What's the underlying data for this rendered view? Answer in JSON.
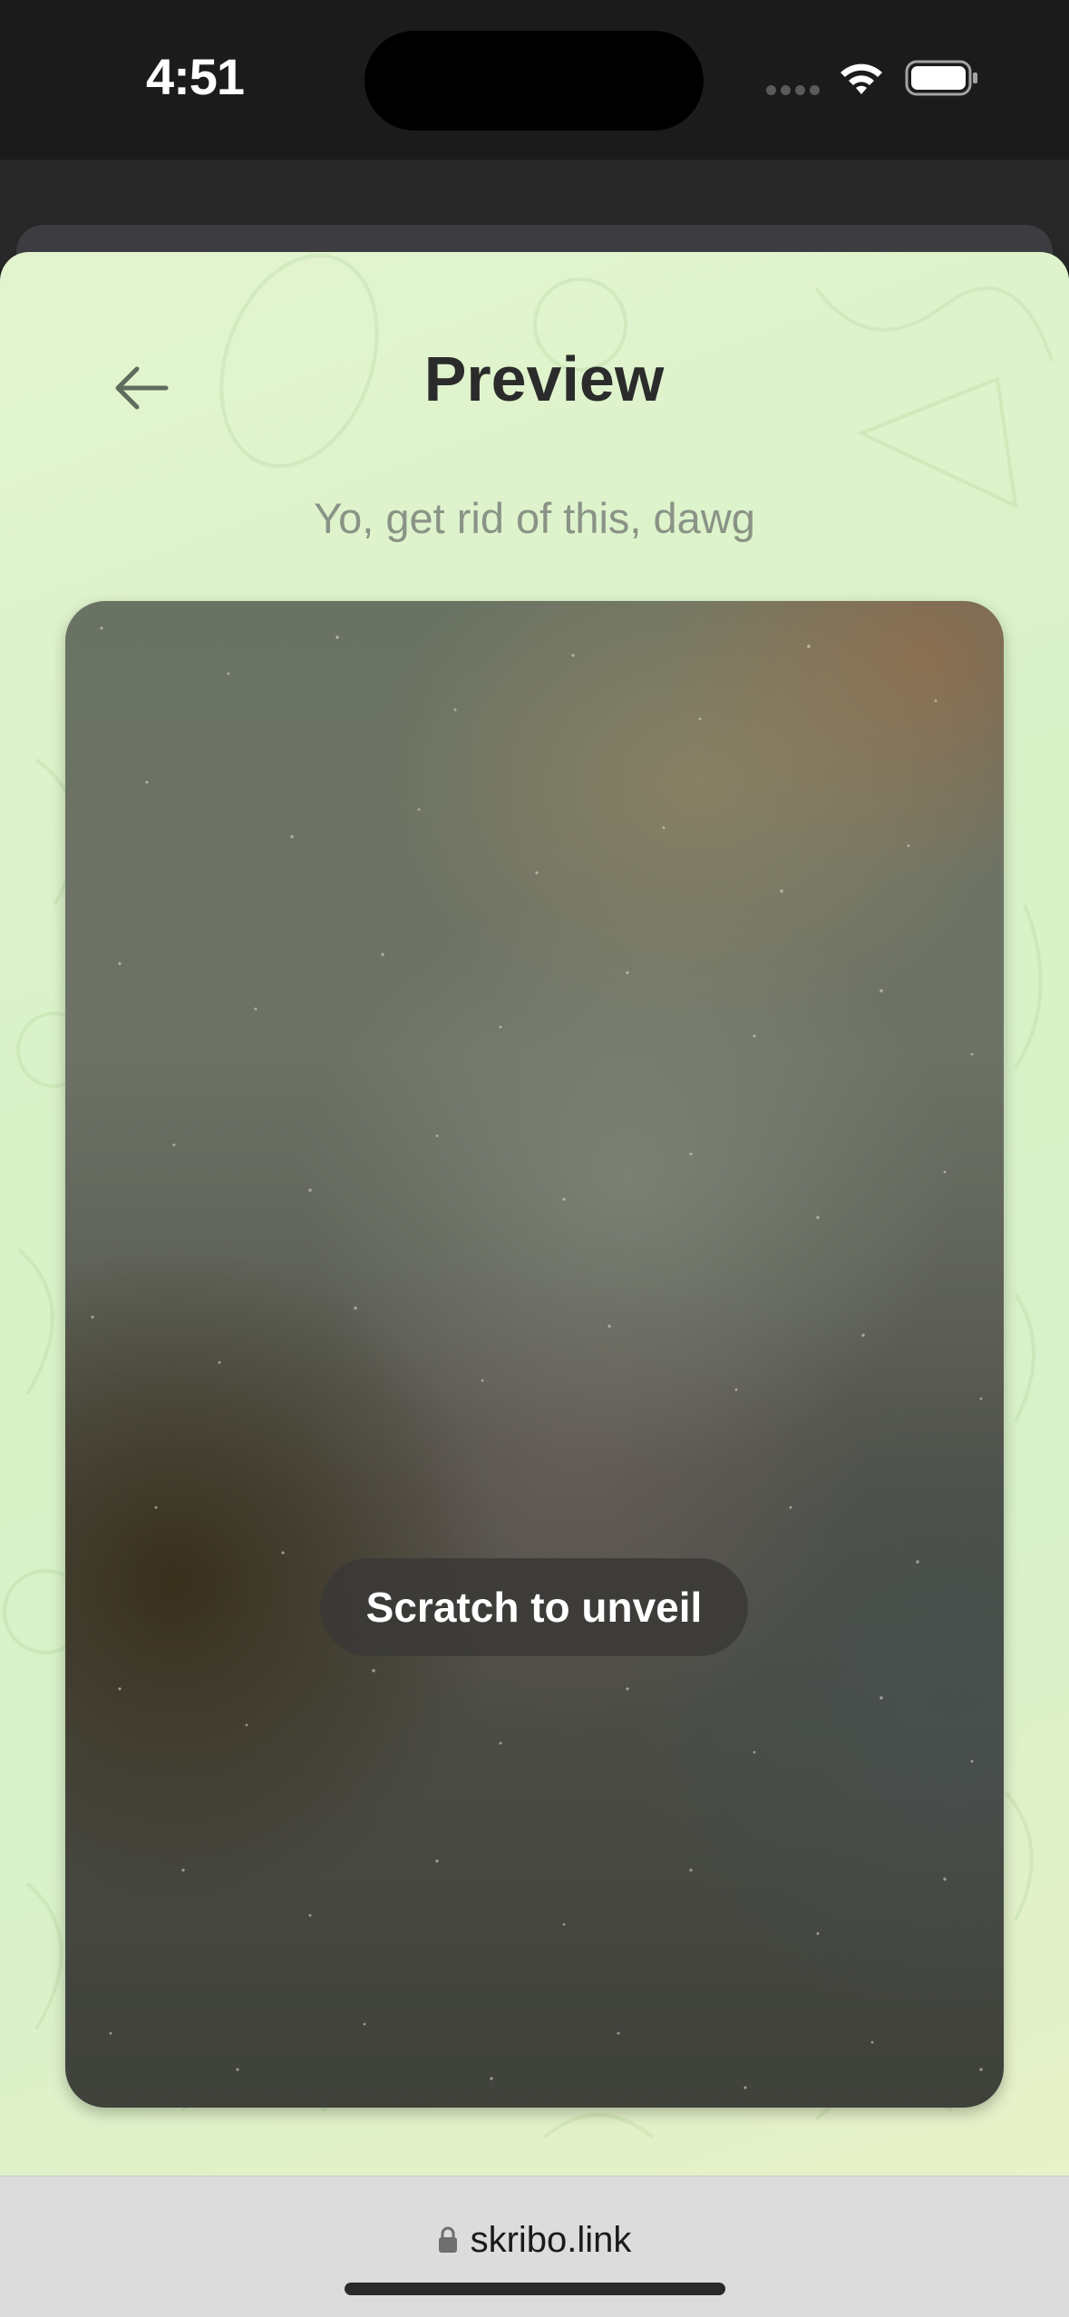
{
  "status_bar": {
    "time": "4:51",
    "icons": [
      "signal-dots",
      "wifi-icon",
      "battery-icon"
    ]
  },
  "header": {
    "title": "Preview",
    "back_icon": "arrow-left-icon"
  },
  "subtitle": "Yo, get rid of this, dawg",
  "scratch_card": {
    "badge_label": "Scratch to unveil"
  },
  "browser": {
    "url": "skribo.link",
    "lock_icon": "lock-icon"
  },
  "colors": {
    "sheet_background": "#dcf3c9",
    "title": "#2b2b2b",
    "subtitle": "#8a9386",
    "badge_background": "#3a3836",
    "browser_bar": "#dcdcdc"
  }
}
